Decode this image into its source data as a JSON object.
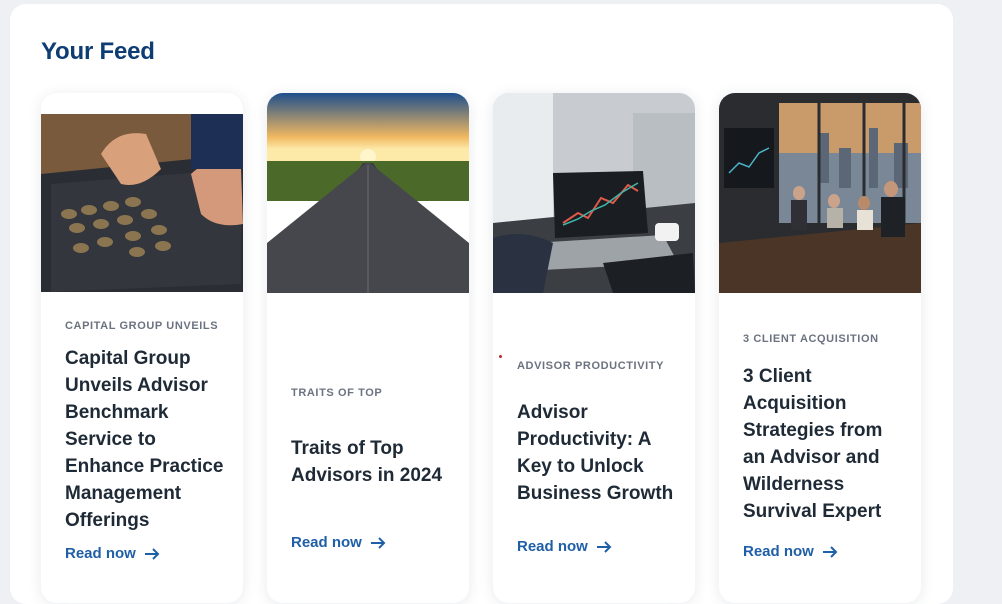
{
  "feed": {
    "title": "Your Feed"
  },
  "cards": [
    {
      "tag": "CAPITAL GROUP UNVEILS",
      "headline": "Capital Group Unveils Advisor Benchmark Service to Enhance Practice Management Offerings",
      "cta": "Read now",
      "image": "hands-arranging-coins-on-slate"
    },
    {
      "tag": "TRAITS OF TOP",
      "headline": "Traits of Top Advisors in 2024",
      "cta": "Read now",
      "image": "road-to-sunset"
    },
    {
      "tag": "ADVISOR PRODUCTIVITY",
      "headline": "Advisor Productivity: A Key to Unlock Business Growth",
      "cta": "Read now",
      "image": "laptop-with-stock-chart-in-office"
    },
    {
      "tag": "3 CLIENT ACQUISITION",
      "headline": "3 Client Acquisition Strategies from an Advisor and Wilderness Survival Expert",
      "cta": "Read now",
      "image": "team-meeting-in-boardroom"
    }
  ],
  "colors": {
    "title": "#0e3d73",
    "link": "#1f5fa6",
    "headline": "#1f2a37",
    "tag": "#6b7280"
  }
}
